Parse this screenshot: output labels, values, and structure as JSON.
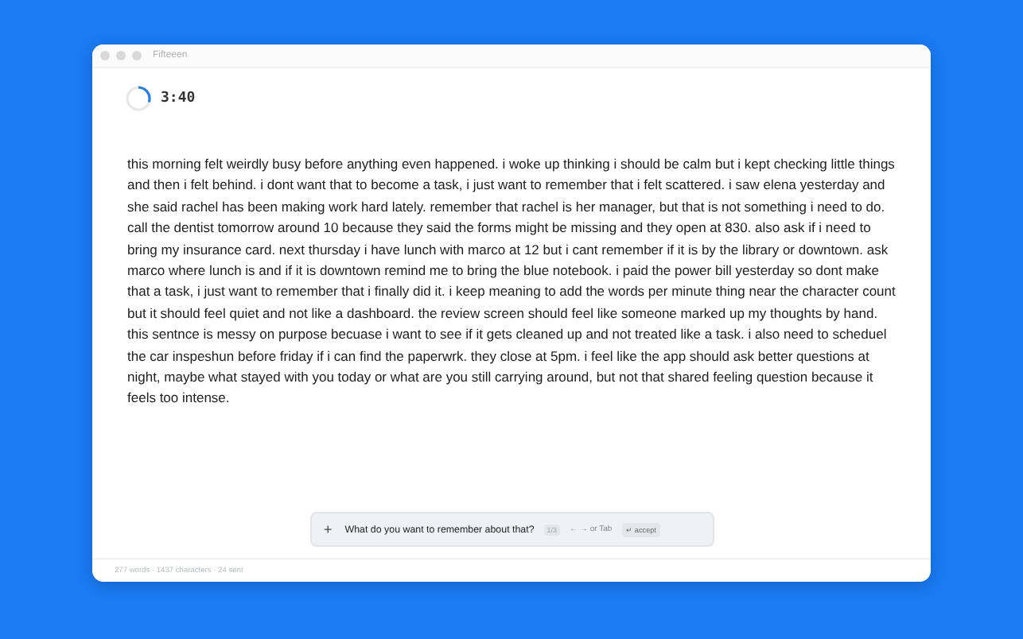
{
  "window": {
    "title": "Fifteeen"
  },
  "timer": {
    "time": "3:40",
    "level": 0.3
  },
  "entry": "this morning felt weirdly busy before anything even happened. i woke up thinking i should be calm but i kept checking little things and then i felt behind. i dont want that to become a task, i just want to remember that i felt scattered. i saw elena yesterday and she said rachel has been making work hard lately. remember that rachel is her manager, but that is not something i need to do. call the dentist tomorrow around 10 because they said the forms might be missing and they open at 830. also ask if i need to bring my insurance card. next thursday i have lunch with marco at 12 but i cant remember if it is by the library or downtown. ask marco where lunch is and if it is downtown remind me to bring the blue notebook. i paid the power bill yesterday so dont make that a task, i just want to remember that i finally did it. i keep meaning to add the words per minute thing near the character count but it should feel quiet and not like a dashboard. the review screen should feel like someone marked up my thoughts by hand. this sentnce is messy on purpose becuase i want to see if it gets cleaned up and not treated like a task. i also need to scheduel the car inspeshun before friday if i can find the paperwrk. they close at 5pm. i feel like the app should ask better questions at night, maybe what stayed with you today or what are you still carrying around, but not that shared feeling question because it feels too intense.",
  "prompt": {
    "plus": "+",
    "question": "What do you want to remember about that?",
    "counter": "1/3",
    "hint": "← → or Tab",
    "accept_key": "↵",
    "accept": "accept"
  },
  "status_bar": "277 words · 1437 characters · 24 sent"
}
